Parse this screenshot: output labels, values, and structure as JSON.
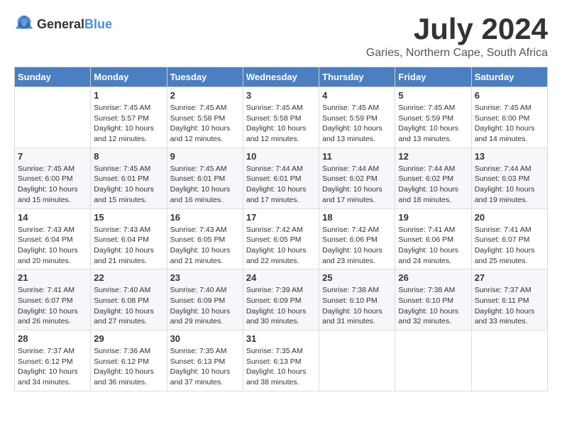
{
  "header": {
    "logo_general": "General",
    "logo_blue": "Blue",
    "month_year": "July 2024",
    "location": "Garies, Northern Cape, South Africa"
  },
  "weekdays": [
    "Sunday",
    "Monday",
    "Tuesday",
    "Wednesday",
    "Thursday",
    "Friday",
    "Saturday"
  ],
  "weeks": [
    [
      {
        "day": "",
        "info": ""
      },
      {
        "day": "1",
        "info": "Sunrise: 7:45 AM\nSunset: 5:57 PM\nDaylight: 10 hours\nand 12 minutes."
      },
      {
        "day": "2",
        "info": "Sunrise: 7:45 AM\nSunset: 5:58 PM\nDaylight: 10 hours\nand 12 minutes."
      },
      {
        "day": "3",
        "info": "Sunrise: 7:45 AM\nSunset: 5:58 PM\nDaylight: 10 hours\nand 12 minutes."
      },
      {
        "day": "4",
        "info": "Sunrise: 7:45 AM\nSunset: 5:59 PM\nDaylight: 10 hours\nand 13 minutes."
      },
      {
        "day": "5",
        "info": "Sunrise: 7:45 AM\nSunset: 5:59 PM\nDaylight: 10 hours\nand 13 minutes."
      },
      {
        "day": "6",
        "info": "Sunrise: 7:45 AM\nSunset: 6:00 PM\nDaylight: 10 hours\nand 14 minutes."
      }
    ],
    [
      {
        "day": "7",
        "info": "Sunrise: 7:45 AM\nSunset: 6:00 PM\nDaylight: 10 hours\nand 15 minutes."
      },
      {
        "day": "8",
        "info": "Sunrise: 7:45 AM\nSunset: 6:01 PM\nDaylight: 10 hours\nand 15 minutes."
      },
      {
        "day": "9",
        "info": "Sunrise: 7:45 AM\nSunset: 6:01 PM\nDaylight: 10 hours\nand 16 minutes."
      },
      {
        "day": "10",
        "info": "Sunrise: 7:44 AM\nSunset: 6:01 PM\nDaylight: 10 hours\nand 17 minutes."
      },
      {
        "day": "11",
        "info": "Sunrise: 7:44 AM\nSunset: 6:02 PM\nDaylight: 10 hours\nand 17 minutes."
      },
      {
        "day": "12",
        "info": "Sunrise: 7:44 AM\nSunset: 6:02 PM\nDaylight: 10 hours\nand 18 minutes."
      },
      {
        "day": "13",
        "info": "Sunrise: 7:44 AM\nSunset: 6:03 PM\nDaylight: 10 hours\nand 19 minutes."
      }
    ],
    [
      {
        "day": "14",
        "info": "Sunrise: 7:43 AM\nSunset: 6:04 PM\nDaylight: 10 hours\nand 20 minutes."
      },
      {
        "day": "15",
        "info": "Sunrise: 7:43 AM\nSunset: 6:04 PM\nDaylight: 10 hours\nand 21 minutes."
      },
      {
        "day": "16",
        "info": "Sunrise: 7:43 AM\nSunset: 6:05 PM\nDaylight: 10 hours\nand 21 minutes."
      },
      {
        "day": "17",
        "info": "Sunrise: 7:42 AM\nSunset: 6:05 PM\nDaylight: 10 hours\nand 22 minutes."
      },
      {
        "day": "18",
        "info": "Sunrise: 7:42 AM\nSunset: 6:06 PM\nDaylight: 10 hours\nand 23 minutes."
      },
      {
        "day": "19",
        "info": "Sunrise: 7:41 AM\nSunset: 6:06 PM\nDaylight: 10 hours\nand 24 minutes."
      },
      {
        "day": "20",
        "info": "Sunrise: 7:41 AM\nSunset: 6:07 PM\nDaylight: 10 hours\nand 25 minutes."
      }
    ],
    [
      {
        "day": "21",
        "info": "Sunrise: 7:41 AM\nSunset: 6:07 PM\nDaylight: 10 hours\nand 26 minutes."
      },
      {
        "day": "22",
        "info": "Sunrise: 7:40 AM\nSunset: 6:08 PM\nDaylight: 10 hours\nand 27 minutes."
      },
      {
        "day": "23",
        "info": "Sunrise: 7:40 AM\nSunset: 6:09 PM\nDaylight: 10 hours\nand 29 minutes."
      },
      {
        "day": "24",
        "info": "Sunrise: 7:39 AM\nSunset: 6:09 PM\nDaylight: 10 hours\nand 30 minutes."
      },
      {
        "day": "25",
        "info": "Sunrise: 7:38 AM\nSunset: 6:10 PM\nDaylight: 10 hours\nand 31 minutes."
      },
      {
        "day": "26",
        "info": "Sunrise: 7:38 AM\nSunset: 6:10 PM\nDaylight: 10 hours\nand 32 minutes."
      },
      {
        "day": "27",
        "info": "Sunrise: 7:37 AM\nSunset: 6:11 PM\nDaylight: 10 hours\nand 33 minutes."
      }
    ],
    [
      {
        "day": "28",
        "info": "Sunrise: 7:37 AM\nSunset: 6:12 PM\nDaylight: 10 hours\nand 34 minutes."
      },
      {
        "day": "29",
        "info": "Sunrise: 7:36 AM\nSunset: 6:12 PM\nDaylight: 10 hours\nand 36 minutes."
      },
      {
        "day": "30",
        "info": "Sunrise: 7:35 AM\nSunset: 6:13 PM\nDaylight: 10 hours\nand 37 minutes."
      },
      {
        "day": "31",
        "info": "Sunrise: 7:35 AM\nSunset: 6:13 PM\nDaylight: 10 hours\nand 38 minutes."
      },
      {
        "day": "",
        "info": ""
      },
      {
        "day": "",
        "info": ""
      },
      {
        "day": "",
        "info": ""
      }
    ]
  ]
}
